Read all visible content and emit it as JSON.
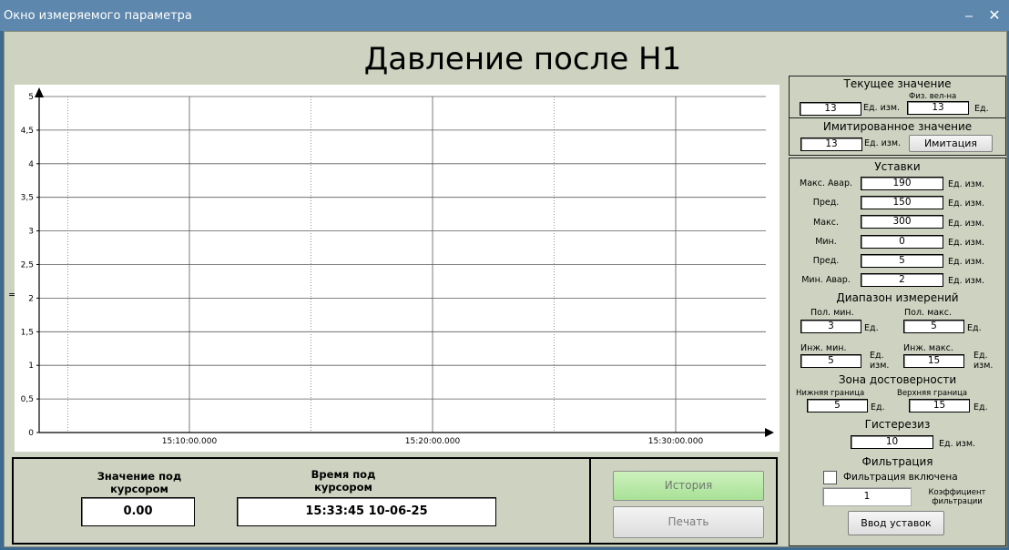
{
  "window": {
    "title": "Окно измеряемого параметра",
    "minimize_glyph": "⎯",
    "close_glyph": "✕"
  },
  "main_title": "Давление после Н1",
  "eq_mark": "=",
  "chart_data": {
    "type": "line",
    "title": "",
    "xlabel": "",
    "ylabel": "",
    "ylim": [
      0,
      5
    ],
    "y_ticks": [
      0,
      0.5,
      1,
      1.5,
      2,
      2.5,
      3,
      3.5,
      4,
      4.5,
      5
    ],
    "y_tick_labels": [
      "0",
      "0,5",
      "1",
      "1,5",
      "2",
      "2,5",
      "3",
      "3,5",
      "4",
      "4,5",
      "5"
    ],
    "x_ticks": [
      "15:10:00.000",
      "15:20:00.000",
      "15:30:00.000"
    ],
    "grid": true,
    "series": []
  },
  "bottom": {
    "cursor_value_label_1": "Значение под",
    "cursor_value_label_2": "курсором",
    "cursor_value": "0.00",
    "cursor_time_label_1": "Время под",
    "cursor_time_label_2": "курсором",
    "cursor_time": "15:33:45  10-06-25",
    "history_button": "История",
    "print_button": "Печать"
  },
  "current": {
    "title": "Текущее значение",
    "value": "13",
    "unit": "Ед. изм.",
    "phys_label": "Физ. вел-на",
    "phys_value": "13",
    "phys_unit": "Ед."
  },
  "imitation": {
    "title": "Имитированное значение",
    "value": "13",
    "unit": "Ед. изм.",
    "button": "Имитация"
  },
  "setpoints": {
    "title": "Уставки",
    "rows": [
      {
        "label": "Макс. Авар.",
        "value": "190",
        "unit": "Ед. изм."
      },
      {
        "label": "Пред.",
        "value": "150",
        "unit": "Ед. изм."
      },
      {
        "label": "Макс.",
        "value": "300",
        "unit": "Ед. изм."
      },
      {
        "label": "Мин.",
        "value": "0",
        "unit": "Ед. изм."
      },
      {
        "label": "Пред.",
        "value": "5",
        "unit": "Ед. изм."
      },
      {
        "label": "Мин. Авар.",
        "value": "2",
        "unit": "Ед. изм."
      }
    ]
  },
  "range": {
    "title": "Диапазон измерений",
    "pol_min_label": "Пол. мин.",
    "pol_min": "3",
    "pol_min_unit": "Ед.",
    "pol_max_label": "Пол. макс.",
    "pol_max": "5",
    "pol_max_unit": "Ед.",
    "inj_min_label": "Инж. мин.",
    "inj_min": "5",
    "inj_min_unit_1": "Ед.",
    "inj_min_unit_2": "изм.",
    "inj_max_label": "Инж. макс.",
    "inj_max": "15",
    "inj_max_unit_1": "Ед.",
    "inj_max_unit_2": "изм."
  },
  "validity": {
    "title": "Зона достоверности",
    "low_label": "Нижняя граница",
    "low_value": "5",
    "low_unit": "Ед.",
    "high_label": "Верхняя граница",
    "high_value": "15",
    "high_unit": "Ед."
  },
  "hysteresis": {
    "title": "Гистерезиз",
    "value": "10",
    "unit": "Ед. изм."
  },
  "filter": {
    "title": "Фильтрация",
    "checkbox_label": "Фильтрация включена",
    "checked": false,
    "coef_value": "1",
    "coef_label_1": "Коэффициент",
    "coef_label_2": "фильтрации"
  },
  "apply_button": "Ввод уставок"
}
